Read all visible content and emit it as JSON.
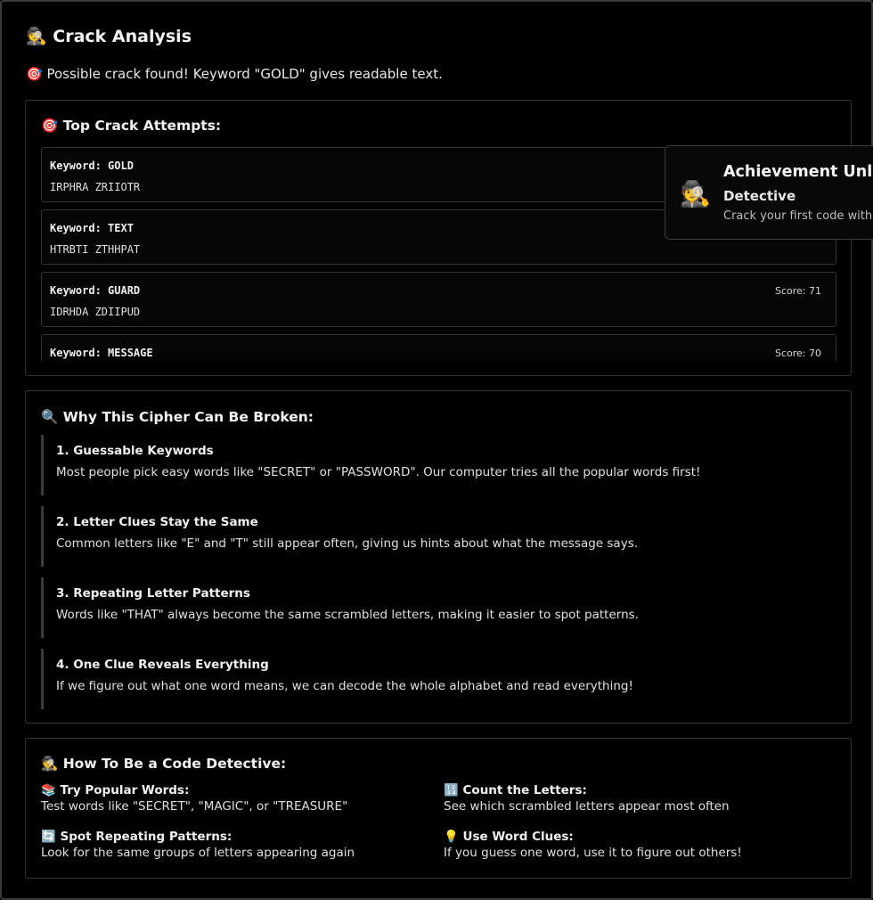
{
  "page": {
    "title": "🕵️ Crack Analysis",
    "result_message": "🎯 Possible crack found! Keyword \"GOLD\" gives readable text."
  },
  "attempts": {
    "heading": "🎯 Top Crack Attempts:",
    "items": [
      {
        "keyword": "Keyword: GOLD",
        "text": "IRPHRA ZRIIOTR",
        "score": ""
      },
      {
        "keyword": "Keyword: TEXT",
        "text": "HTRBTI ZTHHPAT",
        "score": ""
      },
      {
        "keyword": "Keyword: GUARD",
        "text": "IDRHDA ZDIIPUD",
        "score": "Score: 71"
      },
      {
        "keyword": "Keyword: MESSAGE",
        "text": "",
        "score": "Score: 70"
      }
    ]
  },
  "reasons": {
    "heading": "🔍 Why This Cipher Can Be Broken:",
    "items": [
      {
        "title": "1. Guessable Keywords",
        "desc": "Most people pick easy words like \"SECRET\" or \"PASSWORD\". Our computer tries all the popular words first!"
      },
      {
        "title": "2. Letter Clues Stay the Same",
        "desc": "Common letters like \"E\" and \"T\" still appear often, giving us hints about what the message says."
      },
      {
        "title": "3. Repeating Letter Patterns",
        "desc": "Words like \"THAT\" always become the same scrambled letters, making it easier to spot patterns."
      },
      {
        "title": "4. One Clue Reveals Everything",
        "desc": "If we figure out what one word means, we can decode the whole alphabet and read everything!"
      }
    ]
  },
  "tips": {
    "heading": "🕵️ How To Be a Code Detective:",
    "items": [
      {
        "title": "📚 Try Popular Words:",
        "desc": "Test words like \"SECRET\", \"MAGIC\", or \"TREASURE\""
      },
      {
        "title": "🔢 Count the Letters:",
        "desc": "See which scrambled letters appear most often"
      },
      {
        "title": "🔄 Spot Repeating Patterns:",
        "desc": "Look for the same groups of letters appearing again"
      },
      {
        "title": "💡 Use Word Clues:",
        "desc": "If you guess one word, use it to figure out others!"
      }
    ]
  },
  "toast": {
    "icon": "🕵️",
    "title": "Achievement Unlocked!",
    "name": "Detective",
    "desc": "Crack your first code without the keyword"
  }
}
